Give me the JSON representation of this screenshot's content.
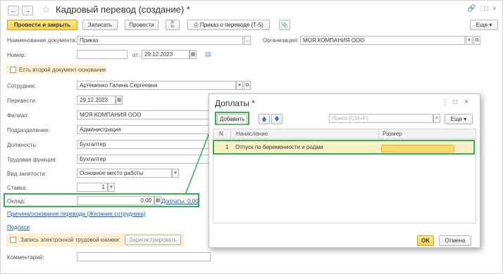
{
  "window": {
    "title": "Кадровый перевод (создание) *",
    "icons": {
      "back": "arrow-left-icon",
      "forward": "arrow-right-icon",
      "favorite": "star-icon",
      "link": "link-icon",
      "more": "more-vert-icon",
      "maximize": "maximize-icon",
      "close": "close-icon"
    }
  },
  "toolbar": {
    "post_close": "Провести и закрыть",
    "save": "Записать",
    "post": "Провести",
    "dt_kt": "Дт\nКт",
    "print_label": "Приказ о переводе (Т-5)",
    "more": "Еще"
  },
  "form": {
    "doc_name_label": "Наименование документа:",
    "doc_name_value": "Приказ",
    "org_label": "Организация:",
    "org_value": "МОЯ КОМПАНИЯ ООО",
    "number_label": "Номер:",
    "number_value": "",
    "date_from_label": "от:",
    "date_value": "29.12.2023",
    "second_basis_label": "Есть второй документ-основание",
    "employee_label": "Сотрудник:",
    "employee_value": "Артёменко Галина Сергеевна",
    "transfer_label": "Перевести:",
    "transfer_value": "29.12.2023",
    "branch_label": "Филиал:",
    "branch_value": "МОЯ КОМПАНИЯ ООО",
    "department_label": "Подразделение:",
    "department_value": "Администрация",
    "position_label": "Должность:",
    "position_value": "Бухгалтер",
    "labor_function_label": "Трудовая функция:",
    "labor_function_value": "Бухгалтер",
    "employment_type_label": "Вид занятости:",
    "employment_type_value": "Основное место работы",
    "rate_label": "Ставка:",
    "rate_value": "1",
    "salary_label": "Оклад:",
    "salary_value": "0,00",
    "allowances_link": "Доплаты: 0,00",
    "reason_link": "Причина/основание перевода (Желание сотрудника)",
    "signatures_link": "Подписи",
    "e_workbook_label": "Запись электронной трудовой книжки:",
    "register_button": "Зарегистрировать",
    "comment_label": "Комментарий:",
    "comment_value": ""
  },
  "dialog": {
    "title": "Доплаты *",
    "add_button": "Добавить",
    "search_placeholder": "Поиск (Ctrl+F)",
    "more_button": "Еще",
    "columns": {
      "n": "N",
      "accrual": "Начисление",
      "amount": "Размер"
    },
    "rows": [
      {
        "n": "1",
        "accrual": "Отпуск по беременности и родам",
        "amount": ""
      }
    ],
    "ok_button": "OK",
    "cancel_button": "Отмена"
  },
  "colors": {
    "primary_button": "#fad34b",
    "annotation_green": "#2fb34a",
    "link": "#1b5fa8",
    "selected_row": "#f7f1c5",
    "active_cell": "#fbdc66"
  }
}
